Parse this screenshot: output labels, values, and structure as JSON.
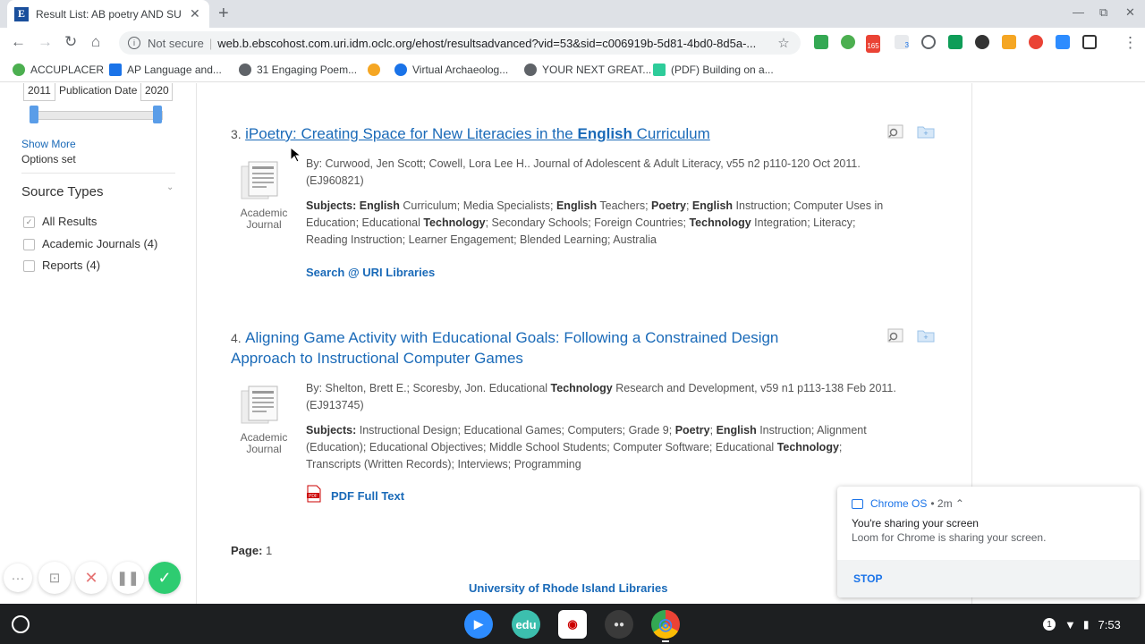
{
  "browser": {
    "tab_title": "Result List: AB poetry AND SU tea",
    "tab_favicon": "E",
    "not_secure": "Not secure",
    "url": "web.b.ebscohost.com.uri.idm.oclc.org/ehost/resultsadvanced?vid=53&sid=c006919b-5d81-4bd0-8d5a-...",
    "ext_badge_1": "165",
    "ext_badge_2": "3"
  },
  "bookmarks": [
    {
      "label": "ACCUPLACER",
      "color": "#4caf50"
    },
    {
      "label": "AP Language and...",
      "color": "#1a73e8"
    },
    {
      "label": "31 Engaging Poem...",
      "color": "#5f6368"
    },
    {
      "label": "",
      "color": "#f5a623"
    },
    {
      "label": "Virtual Archaeolog...",
      "color": "#1a73e8"
    },
    {
      "label": "YOUR NEXT GREAT...",
      "color": "#5f6368"
    },
    {
      "label": "(PDF) Building on a...",
      "color": "#2ecc9a"
    }
  ],
  "sidebar": {
    "pub_from": "2011",
    "pub_label": "Publication Date",
    "pub_to": "2020",
    "show_more": "Show More",
    "options_set": "Options set",
    "source_types_title": "Source Types",
    "source_types": [
      {
        "label": "All Results",
        "checked": true
      },
      {
        "label": "Academic Journals (4)",
        "checked": false
      },
      {
        "label": "Reports (4)",
        "checked": false
      }
    ]
  },
  "results": [
    {
      "num": "3.",
      "title_1": "iPoetry: Creating Space for New Literacies in the ",
      "title_bold": "English",
      "title_2": " Curriculum",
      "doc_type_1": "Academic",
      "doc_type_2": "Journal",
      "byline_1": "By: Curwood, Jen Scott; Cowell, Lora Lee H.. Journal of Adolescent & Adult Literacy, v55 n2 p110-120 Oct 2011.",
      "byline_2": "(EJ960821)",
      "subjects_label": "Subjects:",
      "link": "Search @ URI Libraries"
    },
    {
      "num": "4.",
      "title_1": "Aligning Game Activity with Educational Goals: Following a Constrained Design",
      "title_2": "Approach to Instructional Computer Games",
      "doc_type_1": "Academic",
      "doc_type_2": "Journal",
      "byline_a": "By: Shelton, Brett E.; Scoresby, Jon. Educational ",
      "byline_bold": "Technology",
      "byline_b": " Research and Development, v59 n1 p113-138 Feb 2011.",
      "byline_2": "(EJ913745)",
      "subjects_label": "Subjects:",
      "link": "PDF Full Text"
    }
  ],
  "subj3": {
    "l1": [
      [
        "b",
        "English"
      ],
      [
        "t",
        " Curriculum; Media Specialists; "
      ],
      [
        "b",
        "English"
      ],
      [
        "t",
        " Teachers; "
      ],
      [
        "b",
        "Poetry"
      ],
      [
        "t",
        "; "
      ],
      [
        "b",
        "English"
      ],
      [
        "t",
        " Instruction; Computer Uses in"
      ]
    ],
    "l2": [
      [
        "t",
        "Education; Educational "
      ],
      [
        "b",
        "Technology"
      ],
      [
        "t",
        "; Secondary Schools; Foreign Countries; "
      ],
      [
        "b",
        "Technology"
      ],
      [
        "t",
        " Integration; Literacy;"
      ]
    ],
    "l3": [
      [
        "t",
        "Reading Instruction; Learner Engagement; Blended Learning; Australia"
      ]
    ]
  },
  "subj4": {
    "l1": [
      [
        "t",
        "Instructional Design; Educational Games; Computers; Grade 9; "
      ],
      [
        "b",
        "Poetry"
      ],
      [
        "t",
        "; "
      ],
      [
        "b",
        "English"
      ],
      [
        "t",
        " Instruction; Alignment"
      ]
    ],
    "l2": [
      [
        "t",
        "(Education); Educational Objectives; Middle School Students; Computer Software; Educational "
      ],
      [
        "b",
        "Technology"
      ],
      [
        "t",
        ";"
      ]
    ],
    "l3": [
      [
        "t",
        "Transcripts (Written Records); Interviews; Programming"
      ]
    ]
  },
  "pagination": {
    "label": "Page:",
    "value": "1"
  },
  "footer": "University of Rhode Island Libraries",
  "notification": {
    "source": "Chrome OS",
    "time": "• 2m ⌃",
    "heading": "You're sharing your screen",
    "body": "Loom for Chrome is sharing your screen.",
    "action": "STOP"
  },
  "shelf": {
    "notif_count": "1",
    "time": "7:53",
    "apps": [
      {
        "name": "zoom",
        "color": "#2d8cff",
        "label": "▶"
      },
      {
        "name": "edu",
        "color": "#3cbfae",
        "label": "edu"
      },
      {
        "name": "screencastify",
        "color": "#ffffff",
        "label": "◉"
      },
      {
        "name": "meet",
        "color": "#2c2c2c",
        "label": "●●"
      },
      {
        "name": "chrome",
        "color": "#ea4335",
        "label": "◎"
      }
    ]
  }
}
